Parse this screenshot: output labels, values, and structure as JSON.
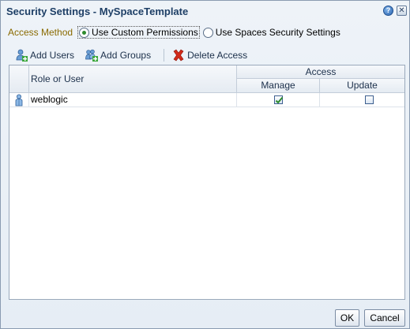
{
  "dialog": {
    "title": "Security Settings - MySpaceTemplate",
    "help_glyph": "?",
    "close_glyph": "✕"
  },
  "access_method": {
    "label": "Access Method",
    "options": [
      {
        "label": "Use Custom Permissions",
        "selected": true
      },
      {
        "label": "Use Spaces Security Settings",
        "selected": false
      }
    ]
  },
  "toolbar": {
    "add_users": "Add Users",
    "add_groups": "Add Groups",
    "delete_access": "Delete Access",
    "icons": {
      "add_users": "add-user-icon",
      "add_groups": "add-group-icon",
      "delete_access": "delete-x-icon"
    }
  },
  "table": {
    "col_role": "Role or User",
    "col_access": "Access",
    "col_manage": "Manage",
    "col_update": "Update",
    "rows": [
      {
        "name": "weblogic",
        "manage": true,
        "update": false
      }
    ]
  },
  "buttons": {
    "ok": "OK",
    "cancel": "Cancel"
  },
  "colors": {
    "title": "#1e3f66",
    "access_label": "#8a6a00",
    "delete_red": "#d12a1a"
  }
}
